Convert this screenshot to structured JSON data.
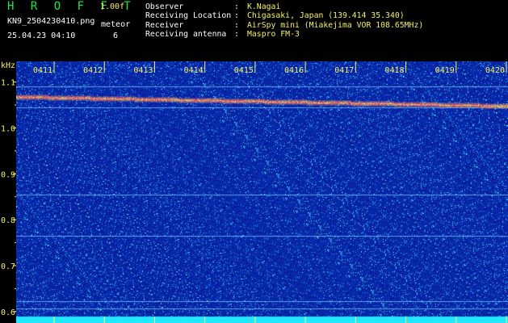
{
  "header": {
    "logo": "H R O F F T",
    "version": "1.00f",
    "filename": "KN9_2504230410.png",
    "timestamp": "25.04.23 04:10",
    "meteor_label": "meteor",
    "meteor_count": "6",
    "info": [
      {
        "key": "Observer",
        "value": "K.Nagai"
      },
      {
        "key": "Receiving Location",
        "value": "Chigasaki, Japan (139.414 35.340)"
      },
      {
        "key": "Receiver",
        "value": "AirSpy mini (Miakejima VOR 108.65MHz)"
      },
      {
        "key": "Receiving antenna",
        "value": "Maspro FM-3"
      }
    ]
  },
  "spectrogram": {
    "unit_label": "kHz",
    "time_ticks": [
      "0411",
      "0412",
      "0413",
      "0414",
      "0415",
      "0416",
      "0417",
      "0418",
      "0419",
      "0420"
    ],
    "freq_ticks": [
      "1.1",
      "1.0",
      "0.9",
      "0.8",
      "0.7",
      "0.6"
    ],
    "freq_values": [
      1.1,
      1.0,
      0.9,
      0.8,
      0.7,
      0.6
    ],
    "freq_range": [
      0.575,
      1.145
    ],
    "carrier_start_khz": 1.068,
    "carrier_end_khz": 1.048,
    "horizontal_lines_khz": [
      1.09,
      1.045,
      0.855,
      0.765,
      0.622,
      0.607
    ],
    "colors": {
      "background": "#0a1aa0",
      "text": "#f4f06a",
      "carrier": "#ff4060",
      "baseline": "#22e8ff"
    }
  }
}
